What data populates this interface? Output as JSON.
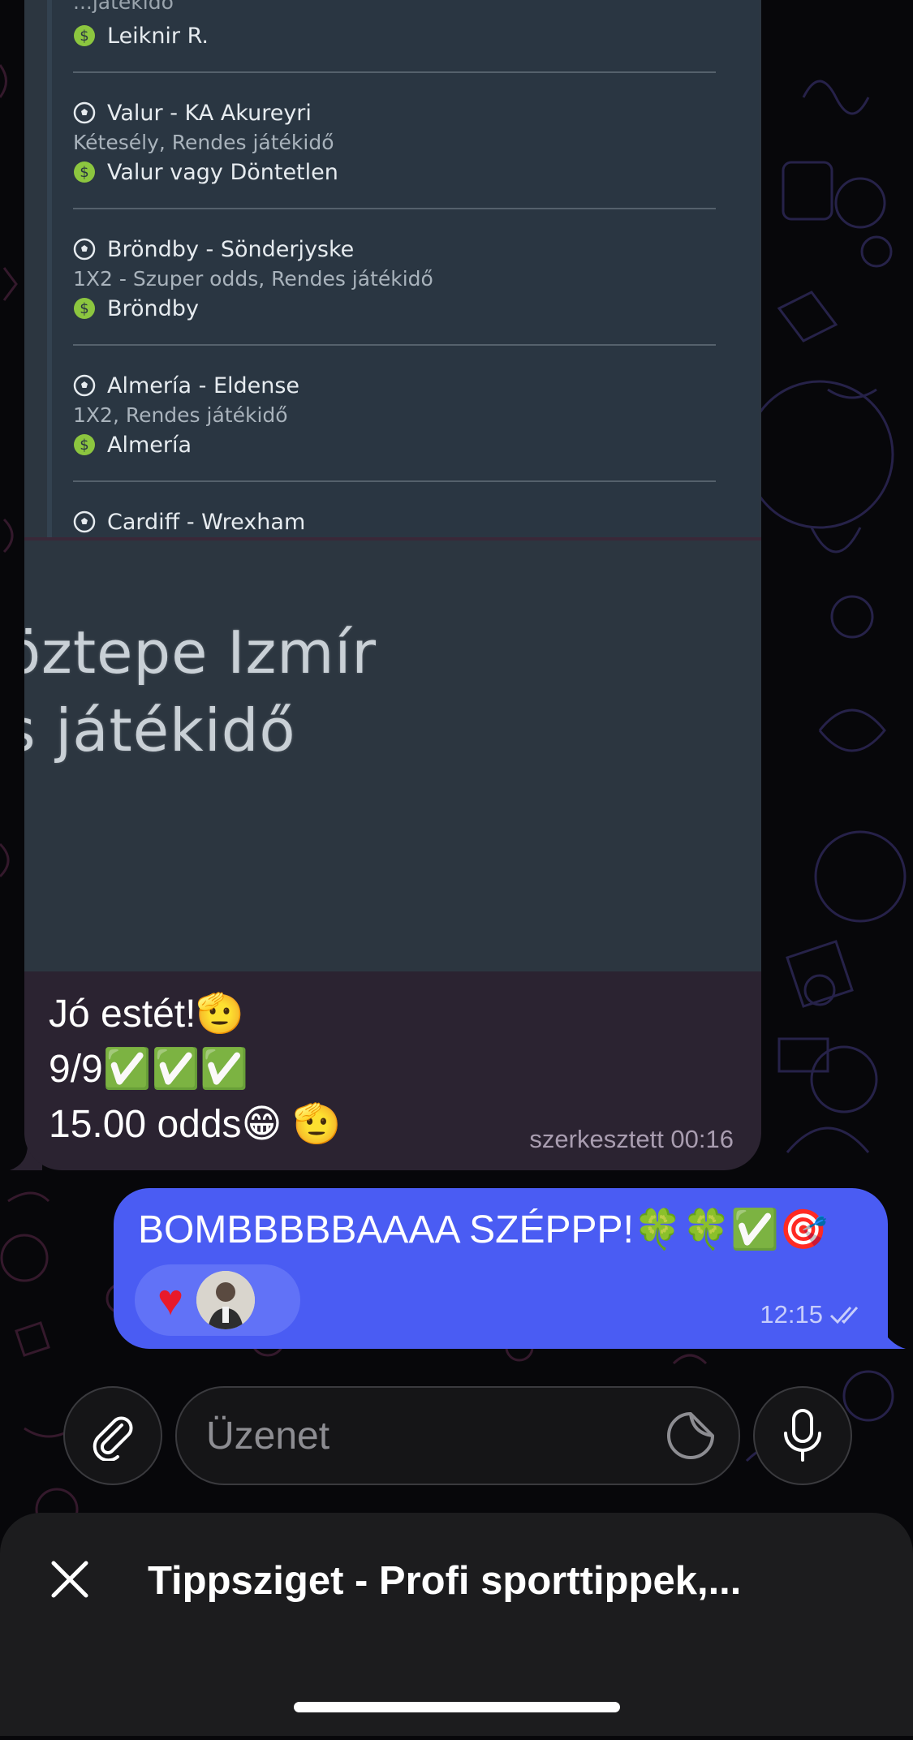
{
  "bet_slip": {
    "cropped_top_text": "...játékidő",
    "bets": [
      {
        "pick": "Leiknir R."
      },
      {
        "match": "Valur - KA Akureyri",
        "market": "Kétesély, Rendes játékidő",
        "pick": "Valur vagy Döntetlen"
      },
      {
        "match": "Bröndby - Sönderjyske",
        "market": "1X2 - Szuper odds, Rendes játékidő",
        "pick": "Bröndby"
      },
      {
        "match": "Almería - Eldense",
        "market": "1X2, Rendes játékidő",
        "pick": "Almería"
      },
      {
        "match": "Cardiff - Wrexham"
      }
    ],
    "zoomed_line1": "öztepe Izmír",
    "zoomed_line2": "s játékidő"
  },
  "incoming_message": {
    "lines": [
      "Jó estét!🫡",
      "9/9✅✅✅",
      "15.00 odds😁 🫡"
    ],
    "meta": "szerkesztett 00:16"
  },
  "outgoing_message": {
    "text": "BOMBBBBBAAAA SZÉPPP!🍀🍀✅🎯",
    "reaction": "♥",
    "time": "12:15"
  },
  "composer": {
    "placeholder": "Üzenet"
  },
  "bottom_sheet": {
    "title": "Tippsziget - Profi sporttippek,..."
  },
  "colors": {
    "outgoing_bubble": "#4a5cf3",
    "incoming_bubble": "#2b2331",
    "pick_icon": "#8cc63f"
  },
  "icons": [
    "soccer-ball-icon",
    "dollar-coin-icon",
    "paperclip-icon",
    "sticker-icon",
    "microphone-icon",
    "close-icon",
    "double-check-icon"
  ]
}
